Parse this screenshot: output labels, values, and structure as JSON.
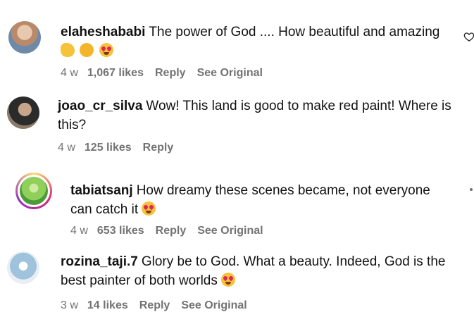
{
  "comments": [
    {
      "username": "elaheshababi",
      "text": "The power of God .... How beautiful and amazing",
      "emojis": [
        "clap-emoji",
        "hug-emoji",
        "heart-eyes-emoji"
      ],
      "time": "4 w",
      "likes": "1,067 likes",
      "reply": "Reply",
      "see_original": "See Original",
      "avatar_colors": [
        "#b88a6a",
        "#6e8aa8"
      ]
    },
    {
      "username": "joao_cr_silva",
      "text": "Wow! This land is good to make red paint! Where is this?",
      "time": "4 w",
      "likes": "125 likes",
      "reply": "Reply",
      "avatar_colors": [
        "#2b2b2b",
        "#8a7a6a"
      ]
    },
    {
      "username": "tabiatsanj",
      "text": "How dreamy these scenes became, not everyone can catch it",
      "emojis": [
        "heart-eyes-emoji"
      ],
      "time": "4 w",
      "likes": "653 likes",
      "reply": "Reply",
      "see_original": "See Original",
      "avatar_colors": [
        "#4c9a3a",
        "#8fcf5a"
      ]
    },
    {
      "username": "rozina_taji.7",
      "text": "Glory be to God. What a beauty. Indeed, God is the best painter of both worlds",
      "emojis": [
        "heart-eyes-emoji"
      ],
      "time": "3 w",
      "likes": "14 likes",
      "reply": "Reply",
      "see_original": "See Original",
      "avatar_colors": [
        "#9fc3dc",
        "#e8eef3"
      ]
    }
  ],
  "colors": {
    "meta_text": "#737373",
    "story_ring": [
      "#feda75",
      "#d62976",
      "#962fbf"
    ]
  }
}
